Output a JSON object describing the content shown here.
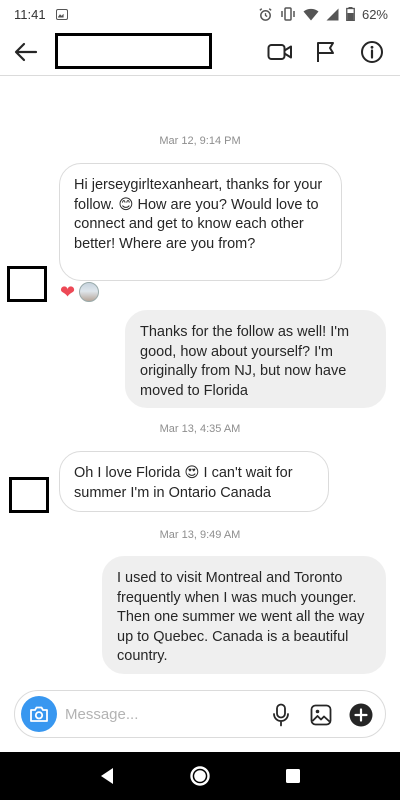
{
  "status_bar": {
    "time": "11:41",
    "battery": "62%",
    "icons": [
      "gallery-icon",
      "alarm-icon",
      "vibrate-icon",
      "wifi-icon",
      "signal-icon",
      "battery-icon"
    ]
  },
  "header": {
    "icons": [
      "back-arrow-icon",
      "video-call-icon",
      "flag-icon",
      "info-icon"
    ]
  },
  "thread": {
    "groups": [
      {
        "timestamp": "Mar 12, 9:14 PM",
        "messages": [
          {
            "direction": "incoming",
            "text": "Hi jerseygirltexanheart, thanks for your follow. 😊 How are you? Would love to connect and get to know each other better! Where are you from?"
          },
          {
            "direction": "outgoing",
            "text": "Thanks for the follow as well! I'm good, how about yourself? I'm originally from NJ, but now have moved to Florida"
          }
        ],
        "reactions": [
          {
            "emoji": "❤",
            "icon": "heart-reaction-icon"
          }
        ]
      },
      {
        "timestamp": "Mar 13, 4:35 AM",
        "messages": [
          {
            "direction": "incoming",
            "text": "Oh I love Florida 😍 I can't wait for summer I'm in Ontario Canada"
          }
        ]
      },
      {
        "timestamp": "Mar 13, 9:49 AM",
        "messages": [
          {
            "direction": "outgoing",
            "text": "I used to visit Montreal and Toronto frequently when I was much younger. Then one summer we went all the way up to Quebec. Canada is a beautiful country."
          }
        ]
      }
    ]
  },
  "composer": {
    "placeholder": "Message...",
    "value": "",
    "icons": [
      "camera-icon",
      "microphone-icon",
      "image-icon",
      "plus-icon"
    ]
  },
  "nav_bar": {
    "icons": [
      "back-triangle-icon",
      "home-circle-icon",
      "recents-square-icon"
    ]
  },
  "colors": {
    "accent": "#3897f0",
    "heart": "#ed4956",
    "outgoing_bubble": "#efefef",
    "incoming_border": "#dbdbdb",
    "timestamp": "#8e8e8e"
  }
}
